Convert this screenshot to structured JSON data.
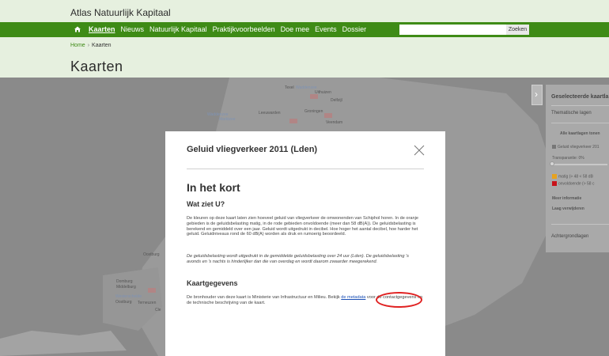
{
  "site": {
    "title": "Atlas Natuurlijk Kapitaal"
  },
  "nav": {
    "items": [
      {
        "label": "Kaarten",
        "active": true
      },
      {
        "label": "Nieuws"
      },
      {
        "label": "Natuurlijk Kapitaal"
      },
      {
        "label": "Praktijkvoorbeelden"
      },
      {
        "label": "Doe mee"
      },
      {
        "label": "Events"
      },
      {
        "label": "Dossier"
      }
    ],
    "search_placeholder": "",
    "search_button": "Zoeken",
    "home_icon": "home-icon"
  },
  "breadcrumb": {
    "home": "Home",
    "separator": "›",
    "current": "Kaarten"
  },
  "page": {
    "title": "Kaarten"
  },
  "map": {
    "labels": [
      "Texel",
      "Waddenzee",
      "Uithuizen",
      "Delfzijl",
      "Leeuwarden",
      "Groningen",
      "Veendam",
      "Waddenzee",
      "Marktzee",
      "Oostburg",
      "Domburg",
      "Middelburg",
      "Westerschelde",
      "Oostburg",
      "Terneuzen",
      "Cle"
    ]
  },
  "side_panel": {
    "toggle_icon": "chevron-right-icon",
    "title": "Geselecteerde kaartla",
    "thematic": "Thematische lagen",
    "show_all": "Alle kaartlagen tonen",
    "layer_check": "Geluid vliegverkeer 201",
    "transparency": "Transparantie: 0%",
    "legend": [
      {
        "label": "matig (> 48 < 58 dB",
        "color": "#e7a21e"
      },
      {
        "label": "onvoldoende (> 58 c",
        "color": "#c8121a"
      }
    ],
    "more_info": "Meer informatie",
    "remove_layer": "Laag verwijderen",
    "basemaps": "Achtergrondlagen"
  },
  "modal": {
    "title": "Geluid vliegverkeer 2011 (Lden)",
    "close_icon": "close-icon",
    "heading": "In het kort",
    "sub1": "Wat ziet U?",
    "para1": "De kleuren op deze kaart laten zien hoeveel geluid van vliegverkeer de omwonenden van Schiphol horen. In de oranje gebieden is de geluidsbelasting matig, in de rode gebieden onvoldoende (meer dan 58 dB(A)). De geluidsbelasting is berekend en gemiddeld over een jaar. Geluid wordt uitgedrukt in decibel. Hoe hoger het aantal decibel, hoe harder het geluid. Geluidniveaus rond de 60 dB(A) worden als druk en rumoerig beoordeeld.",
    "para2": "De geluidsbelasting wordt uitgedrukt in de gemiddelde geluidsbelasting over 24 uur (Lden). De geluidsbelasting 's avonds en 's nachts is hinderlijker dan die van overdag en wordt daarom zwaarder meegerekend.",
    "sub2": "Kaartgegevens",
    "para3_before": "De bronhouder van deze kaart is Ministerie van Infrastructuur en Milieu. Bekijk ",
    "para3_link": "de metadata",
    "para3_after": " voor de contactgegevens en de technische beschrijving van de kaart."
  }
}
